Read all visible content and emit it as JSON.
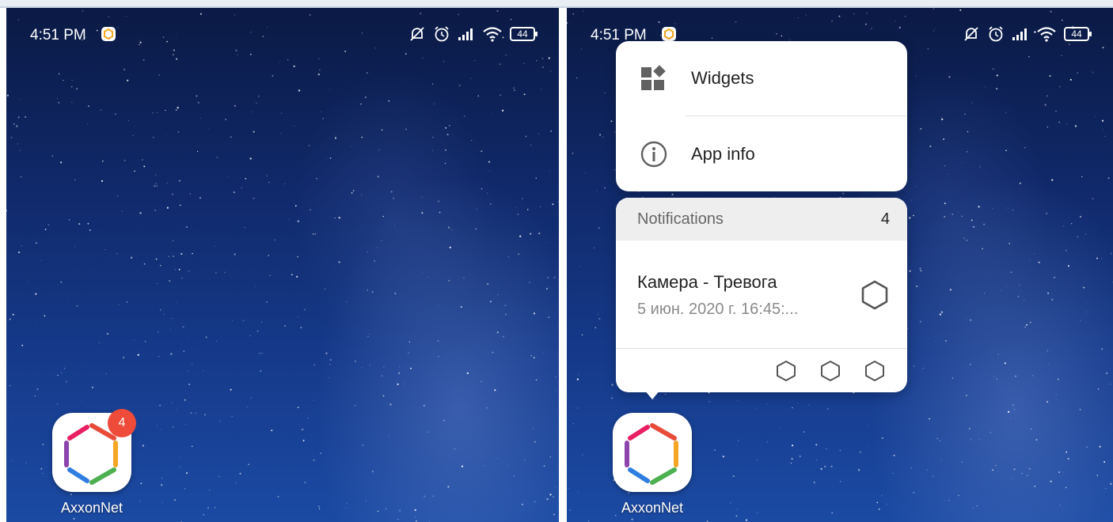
{
  "left_screen": {
    "status_bar": {
      "time": "4:51 PM",
      "battery": "44",
      "icons": [
        "app-logo-icon",
        "notifications-off-icon",
        "alarm-icon",
        "signal-icon",
        "wifi-icon",
        "battery-icon"
      ]
    },
    "app": {
      "label": "AxxonNet",
      "badge_count": "4",
      "icon": "axxonnet-hexagon-icon"
    }
  },
  "right_screen": {
    "status_bar": {
      "time": "4:51 PM",
      "battery": "44"
    },
    "popup_menu": {
      "items": [
        {
          "label": "Widgets",
          "icon": "widgets-icon"
        },
        {
          "label": "App info",
          "icon": "info-icon"
        }
      ]
    },
    "notifications": {
      "header": "Notifications",
      "count": "4",
      "item": {
        "title": "Камера - Тревога",
        "subtitle": "5 июн. 2020 г. 16:45:..."
      }
    },
    "app": {
      "label": "AxxonNet",
      "icon": "axxonnet-hexagon-icon"
    }
  },
  "colors": {
    "badge": "#ee4b3a",
    "wallpaper_top": "#0b1a45",
    "wallpaper_bottom": "#1b4aa3",
    "hex_segments": [
      "#e84b3a",
      "#f5a623",
      "#4caf50",
      "#2f7de1",
      "#8e44ad",
      "#e91e63"
    ]
  }
}
